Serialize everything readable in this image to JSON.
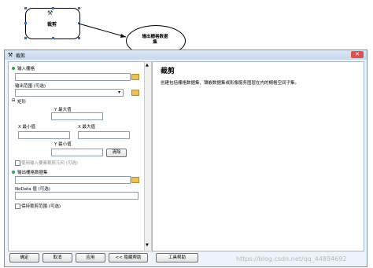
{
  "model": {
    "tool_label": "裁剪",
    "output_label_line1": "输出栅格数据",
    "output_label_line2": "集"
  },
  "dialog": {
    "title": "裁剪",
    "close_glyph": "✕",
    "left": {
      "input_raster_label": "输入栅格",
      "output_extent_label": "输出范围 (可选)",
      "rectangle_label": "矩形",
      "y_max_label": "Y 最大值",
      "x_min_label": "X 最小值",
      "x_max_label": "X 最大值",
      "y_min_label": "Y 最小值",
      "clear_button": "清除",
      "use_geom_label": "使用输入要素裁剪几何 (可选)",
      "output_raster_label": "输出栅格数据集",
      "nodata_label": "NoData 值 (可选)",
      "keep_extent_label": "保持裁剪范围 (可选)"
    },
    "right": {
      "title": "裁剪",
      "description": "创建包括栅格数据集、镶嵌数据集或影像服务图层在内的栅格空间子集。"
    },
    "buttons": {
      "ok": "确定",
      "cancel": "取消",
      "apply": "应用",
      "hide_help": "<< 隐藏帮助",
      "tool_help": "工具帮助"
    }
  },
  "watermark": "https://blog.csdn.net/qq_44894692",
  "colors": {
    "dialog_bg": "#eef3fa",
    "selection": "#2a6fd6",
    "required_dot": "#2ea44f"
  }
}
